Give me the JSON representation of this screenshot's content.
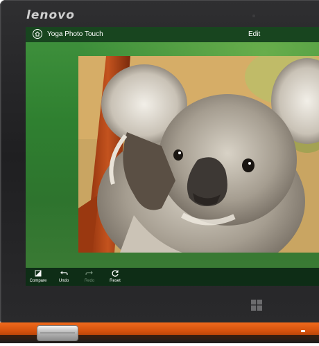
{
  "device": {
    "brand": "lenovo"
  },
  "app": {
    "title": "Yoga Photo Touch",
    "mode_label": "Edit"
  },
  "toolbar": {
    "compare_label": "Compare",
    "undo_label": "Undo",
    "redo_label": "Redo",
    "reset_label": "Reset"
  },
  "icons": {
    "home": "home-icon",
    "compare": "compare-icon",
    "undo": "undo-icon",
    "redo": "redo-icon",
    "reset": "reset-icon",
    "windows": "windows-logo-icon"
  },
  "colors": {
    "accent_orange": "#e8621a",
    "app_green": "#2f8030",
    "toolbar_dark": "#0e2d16"
  },
  "photo": {
    "subject": "koala"
  }
}
